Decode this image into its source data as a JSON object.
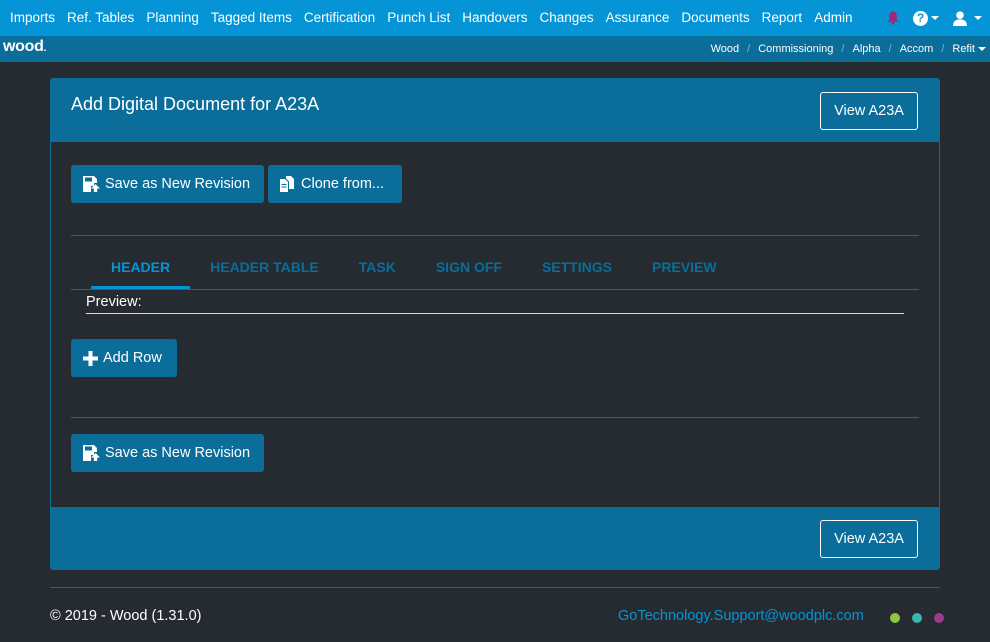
{
  "nav": {
    "items": [
      "Imports",
      "Ref. Tables",
      "Planning",
      "Tagged Items",
      "Certification",
      "Punch List",
      "Handovers",
      "Changes",
      "Assurance",
      "Documents",
      "Report",
      "Admin"
    ],
    "help_glyph": "?",
    "icons": [
      "bell-icon",
      "question-circle-icon",
      "user-icon"
    ],
    "bell_color": "#9b2a7e"
  },
  "brand": {
    "logo": "wood",
    "logo_dot": "."
  },
  "breadcrumb": [
    "Wood",
    "Commissioning",
    "Alpha",
    "Accom",
    "Refit"
  ],
  "breadcrumb_sep": "/",
  "panel": {
    "title": "Add Digital Document for A23A",
    "view_button": "View A23A",
    "save_revision": "Save as New Revision",
    "clone_from": "Clone from...",
    "add_row": "Add Row",
    "preview_label": "Preview:",
    "tabs": [
      {
        "label": "HEADER",
        "active": true
      },
      {
        "label": "HEADER TABLE",
        "active": false
      },
      {
        "label": "TASK",
        "active": false
      },
      {
        "label": "SIGN OFF",
        "active": false
      },
      {
        "label": "SETTINGS",
        "active": false
      },
      {
        "label": "PREVIEW",
        "active": false
      }
    ]
  },
  "footer": {
    "copyright": "© 2019 - Wood (1.31.0)",
    "email": "GoTechnology.Support@woodplc.com",
    "dot_colors": [
      "#8dc63f",
      "#3ab5b0",
      "#9b3c8a"
    ]
  },
  "colors": {
    "accent": "#0594d6",
    "panel": "#0a6d9a",
    "background": "#252b31"
  }
}
